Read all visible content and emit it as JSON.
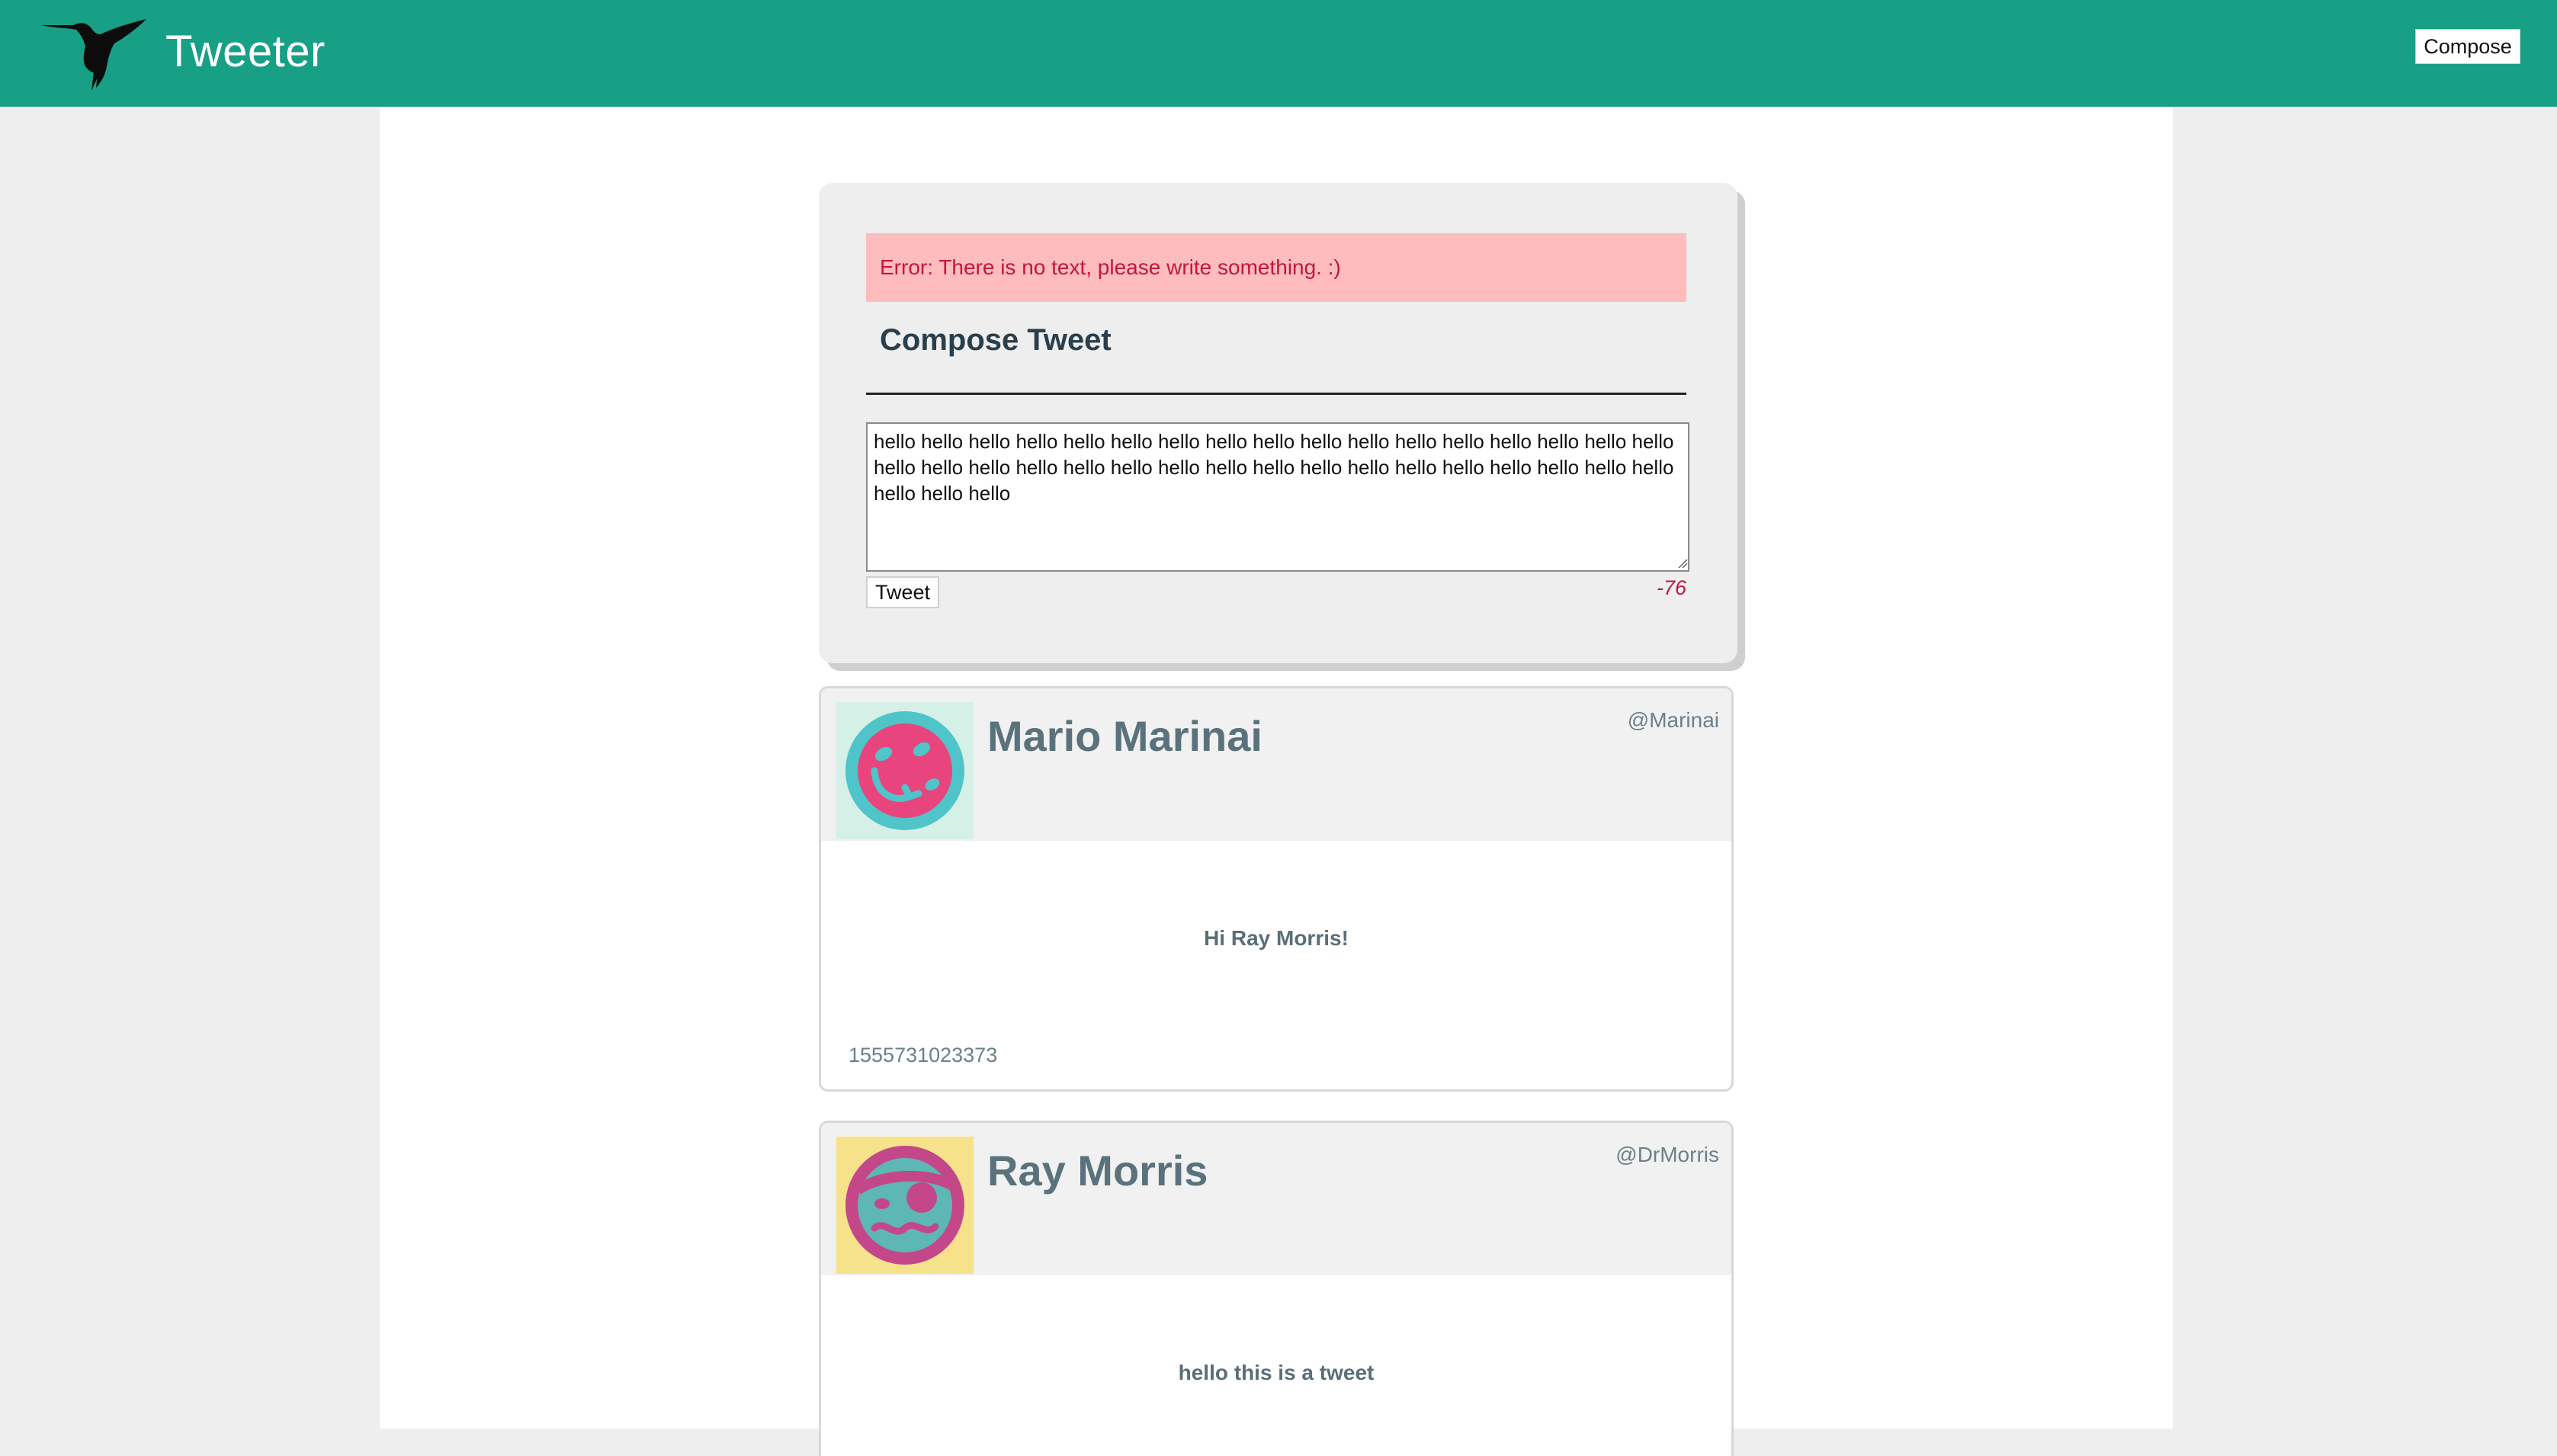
{
  "app": {
    "title": "Tweeter",
    "compose_nav_label": "Compose",
    "brand_color": "#18a086"
  },
  "compose": {
    "error_text": "Error: There is no text, please write something. :)",
    "heading": "Compose Tweet",
    "textarea_value": "hello hello hello hello hello hello hello hello hello hello hello hello hello hello hello hello hello hello hello hello hello hello hello hello hello hello hello hello hello hello hello hello hello hello hello hello hello",
    "tweet_button_label": "Tweet",
    "char_counter": "-76",
    "error_bg": "#ffbcbd",
    "error_color": "#c3163c"
  },
  "tweets": [
    {
      "name": "Mario Marinai",
      "handle": "@Marinai",
      "body": "Hi Ray Morris!",
      "timestamp": "1555731023373",
      "avatar_icon": "smiley-avatar-icon"
    },
    {
      "name": "Ray Morris",
      "handle": "@DrMorris",
      "body": "hello this is a tweet",
      "timestamp": "",
      "avatar_icon": "pirate-avatar-icon"
    }
  ]
}
